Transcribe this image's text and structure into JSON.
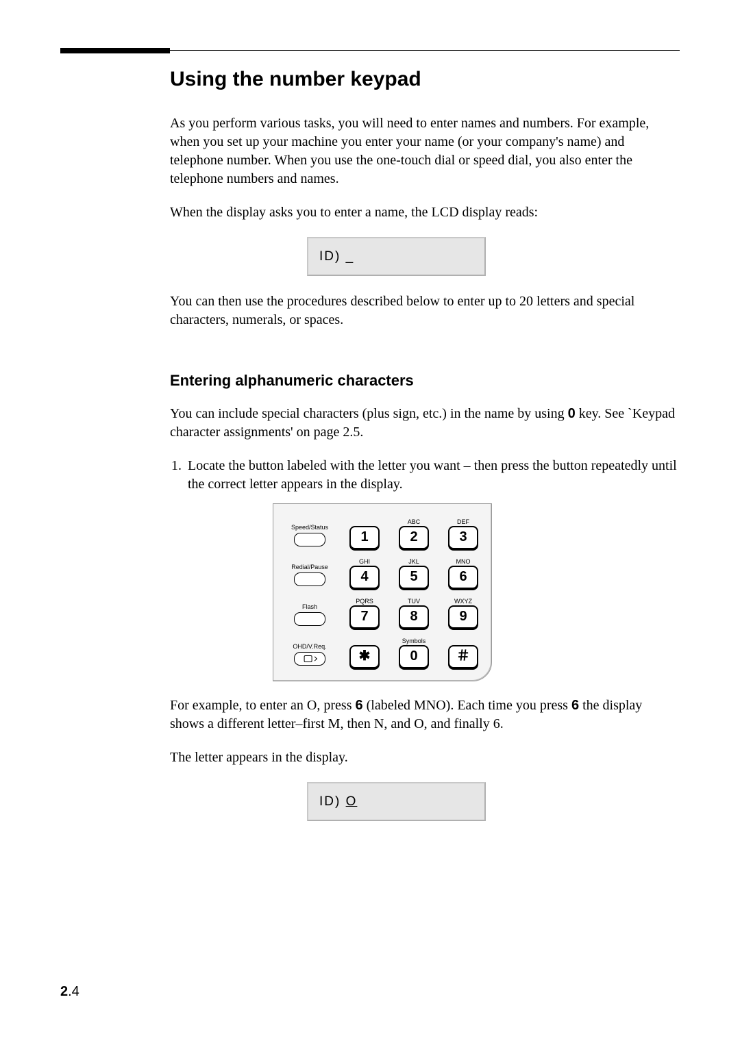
{
  "page": {
    "number_major": "2",
    "number_minor": ".4"
  },
  "title": "Using the number keypad",
  "paragraphs": {
    "intro": "As you perform various tasks, you will need to enter names and numbers. For example, when you set up your machine you enter your name (or your company's name) and telephone number. When you use the one-touch dial or speed dial, you also enter the telephone numbers and names.",
    "display_prompt_intro": "When the display asks you to enter a name, the LCD display reads:",
    "after_lcd1": "You can then use the procedures described below to enter up to 20 letters and special characters, numerals, or spaces.",
    "subhead": "Entering alphanumeric characters",
    "special_chars_pre": "You can include special characters (plus sign, etc.) in the name by using ",
    "special_chars_key": "0",
    "special_chars_post": " key. See `Keypad character assignments' on page 2.5.",
    "step1": "Locate the button labeled with the letter you want – then press the button repeatedly until the correct letter appears in the display.",
    "example_pre": "For example, to enter an O, press ",
    "example_key1": "6",
    "example_mid1": " (labeled MNO). Each time you press ",
    "example_key2": "6",
    "example_mid2": " the display shows a different letter–first M, then N, and O, and finally 6.",
    "letter_appears": "The letter appears in the display."
  },
  "lcd1": {
    "prefix": "ID) ",
    "entry": "_"
  },
  "lcd2": {
    "prefix": "ID) ",
    "entry": "O"
  },
  "keypad": {
    "side": [
      {
        "label": "Speed/Status",
        "type": "plain"
      },
      {
        "label": "Redial/Pause",
        "type": "plain"
      },
      {
        "label": "Flash",
        "type": "plain"
      },
      {
        "label": "OHD/V.Req.",
        "type": "speaker"
      }
    ],
    "rows": [
      [
        {
          "top": "",
          "key": "1"
        },
        {
          "top": "ABC",
          "key": "2"
        },
        {
          "top": "DEF",
          "key": "3"
        }
      ],
      [
        {
          "top": "GHI",
          "key": "4"
        },
        {
          "top": "JKL",
          "key": "5"
        },
        {
          "top": "MNO",
          "key": "6"
        }
      ],
      [
        {
          "top": "PQRS",
          "key": "7"
        },
        {
          "top": "TUV",
          "key": "8"
        },
        {
          "top": "WXYZ",
          "key": "9"
        }
      ],
      [
        {
          "top": "",
          "key": "✱"
        },
        {
          "top": "Symbols",
          "key": "0"
        },
        {
          "top": "",
          "key": "＃"
        }
      ]
    ]
  }
}
